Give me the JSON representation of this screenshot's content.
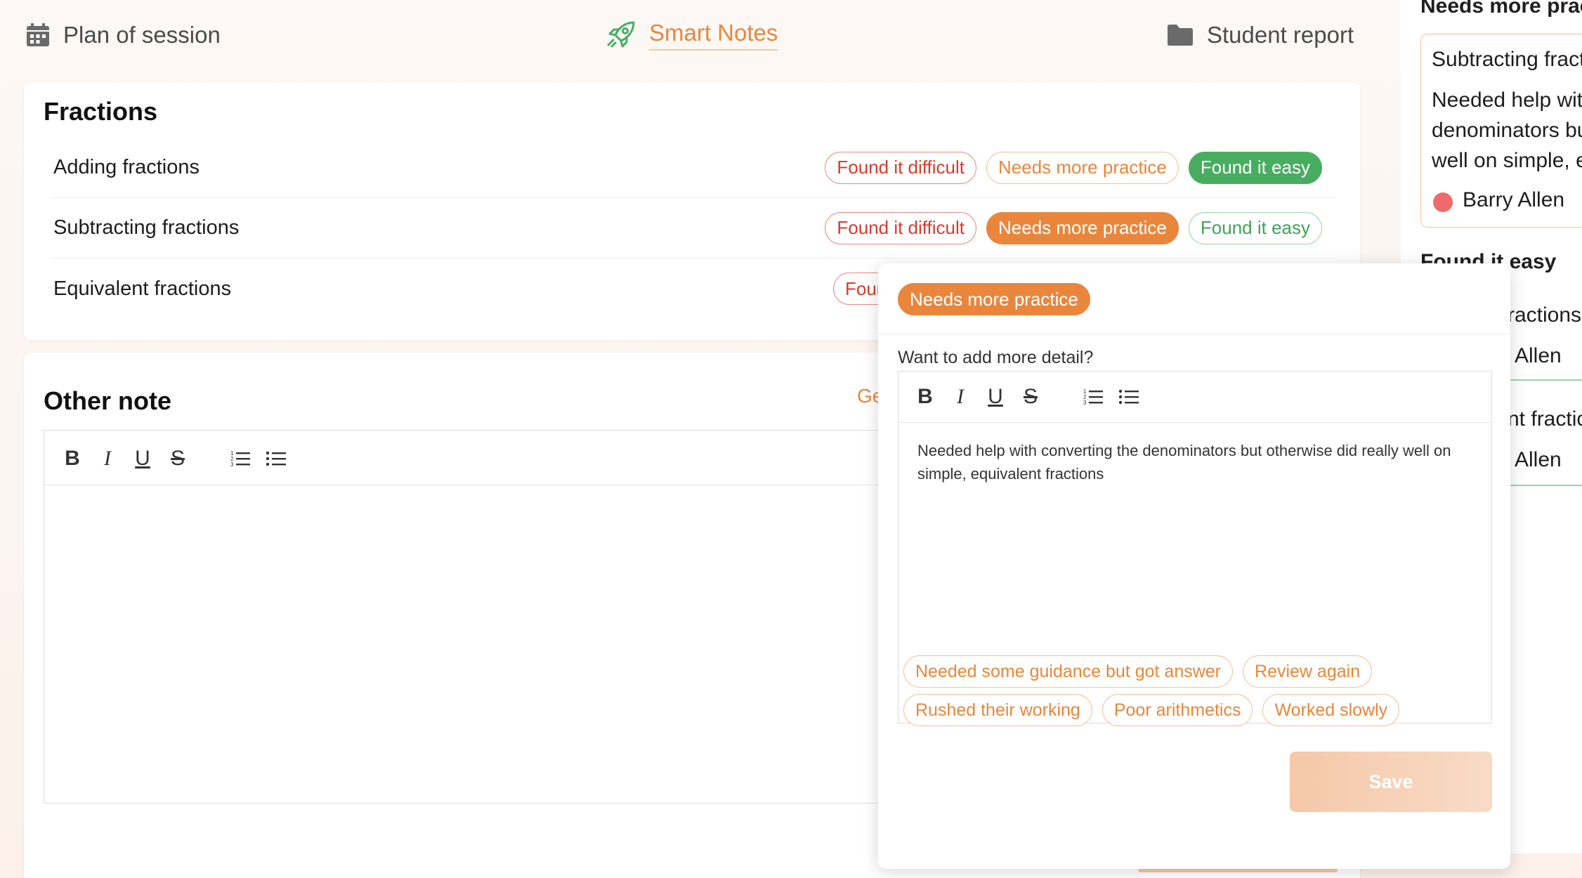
{
  "nav": {
    "plan_label": "Plan of session",
    "notes_label": "Smart Notes",
    "report_label": "Student report"
  },
  "fractions": {
    "title": "Fractions",
    "topics": [
      {
        "name": "Adding fractions",
        "selected": "Found it easy"
      },
      {
        "name": "Subtracting fractions",
        "selected": "Needs more practice"
      },
      {
        "name": "Equivalent fractions",
        "selected": ""
      }
    ],
    "chip_labels": {
      "difficult": "Found it difficult",
      "practice": "Needs more practice",
      "easy": "Found it easy"
    },
    "partial_chip": "Foun"
  },
  "other_note": {
    "title": "Other note",
    "partial_link": "Ge",
    "toolbar": [
      "B",
      "I",
      "U",
      "S"
    ]
  },
  "right_panel": {
    "heading_practice": "Needs more prac",
    "card_title": "Subtracting fract",
    "card_text": [
      "Needed help with",
      "denominators bu",
      "well on simple, ec"
    ],
    "student": "Barry Allen",
    "heading_easy": "Found it easy",
    "easy_items": [
      {
        "title": "ractions",
        "student": "Allen"
      },
      {
        "title": "nt fractio",
        "student": "Allen"
      }
    ]
  },
  "popup": {
    "selected_chip": "Needs more practice",
    "prompt": "Want to add more detail?",
    "editor_text": "Needed help with converting the denominators but otherwise did really well on simple, equivalent fractions",
    "suggestions_row1": [
      "Needed some guidance but got answer",
      "Review again"
    ],
    "suggestions_row2": [
      "Rushed their working",
      "Poor arithmetics",
      "Worked slowly"
    ],
    "save_label": "Save"
  },
  "colors": {
    "accent": "#e9863c",
    "difficult": "#d93a2f",
    "easy": "#47ad61",
    "student_dot": "#ef6b6b"
  }
}
